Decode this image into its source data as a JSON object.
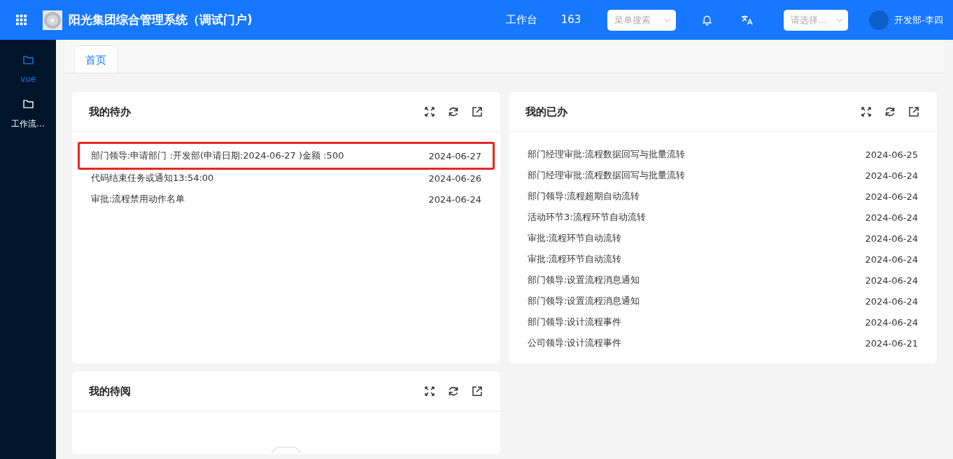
{
  "header": {
    "title": "阳光集团综合管理系统（调试门户)",
    "nav": [
      "工作台",
      "163"
    ],
    "menu_search": {
      "placeholder": "菜单搜索"
    },
    "select": {
      "placeholder": "请选择..."
    },
    "user": "开发部-李四"
  },
  "sidebar": {
    "items": [
      {
        "label": "vue",
        "selected": true
      },
      {
        "label": "工作流...",
        "selected": false
      }
    ]
  },
  "tabs": [
    {
      "label": "首页",
      "selected": true
    }
  ],
  "cards": [
    {
      "title": "我的待办",
      "rows": [
        {
          "text": "部门领导:申请部门 :开发部(申请日期:2024-06-27 )金额 :500",
          "date": "2024-06-27",
          "highlighted": true
        },
        {
          "text": "代码结束任务或通知13:54:00",
          "date": "2024-06-26",
          "highlighted": false
        },
        {
          "text": "审批:流程禁用动作名单",
          "date": "2024-06-24",
          "highlighted": false
        }
      ]
    },
    {
      "title": "我的已办",
      "rows": [
        {
          "text": "部门经理审批:流程数据回写与批量流转",
          "date": "2024-06-25",
          "highlighted": false
        },
        {
          "text": "部门经理审批:流程数据回写与批量流转",
          "date": "2024-06-24",
          "highlighted": false
        },
        {
          "text": "部门领导:流程超期自动流转",
          "date": "2024-06-24",
          "highlighted": false
        },
        {
          "text": "活动环节3:流程环节自动流转",
          "date": "2024-06-24",
          "highlighted": false
        },
        {
          "text": "审批:流程环节自动流转",
          "date": "2024-06-24",
          "highlighted": false
        },
        {
          "text": "审批:流程环节自动流转",
          "date": "2024-06-24",
          "highlighted": false
        },
        {
          "text": "部门领导:设置流程消息通知",
          "date": "2024-06-24",
          "highlighted": false
        },
        {
          "text": "部门领导:设置流程消息通知",
          "date": "2024-06-24",
          "highlighted": false
        },
        {
          "text": "部门领导:设计流程事件",
          "date": "2024-06-24",
          "highlighted": false
        },
        {
          "text": "公司领导:设计流程事件",
          "date": "2024-06-21",
          "highlighted": false
        }
      ]
    },
    {
      "title": "我的待阅"
    }
  ]
}
